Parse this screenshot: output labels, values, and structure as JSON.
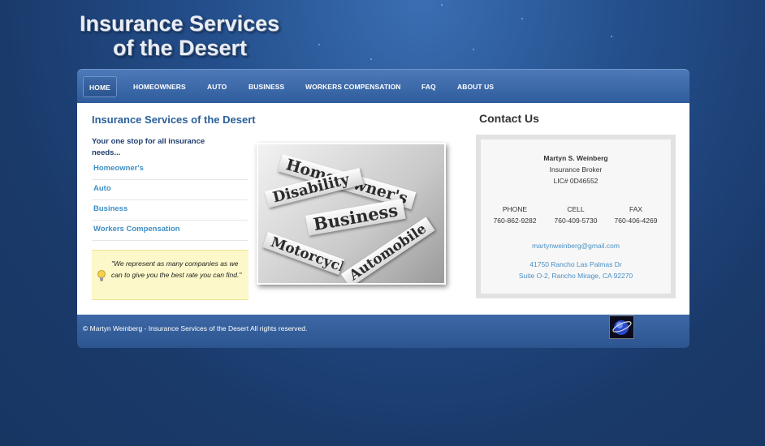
{
  "header": {
    "title_line1": "Insurance Services",
    "title_line2": "of the Desert"
  },
  "nav": {
    "items": [
      {
        "label": "HOME",
        "active": true
      },
      {
        "label": "HOMEOWNERS"
      },
      {
        "label": "AUTO"
      },
      {
        "label": "BUSINESS"
      },
      {
        "label": "WORKERS COMPENSATION"
      },
      {
        "label": "FAQ"
      },
      {
        "label": "ABOUT US"
      }
    ]
  },
  "main": {
    "heading": "Insurance Services of the Desert",
    "tagline": "Your one stop for all insurance needs...",
    "links": [
      "Homeowner's",
      "Auto",
      "Business",
      "Workers Compensation"
    ],
    "quote": "\"We represent as many companies as we can to give you the best rate you can find.\"",
    "quote_icon": "lightbulb-icon",
    "photo_words": [
      "Home Owner's",
      "Disability",
      "Business",
      "Motorcycle",
      "Automobile"
    ]
  },
  "contact": {
    "heading": "Contact Us",
    "name": "Martyn S. Weinberg",
    "title": "Insurance Broker",
    "license": "LIC# 0D46552",
    "phone_label": "PHONE",
    "phone": "760-862-9282",
    "cell_label": "CELL",
    "cell": "760-409-5730",
    "fax_label": "FAX",
    "fax": "760-406-4269",
    "email": "martynweinberg@gmail.com",
    "address_line1": "41750 Rancho Las Palmas Dr",
    "address_line2": "Suite O-2, Rancho Mirage, CA 92270"
  },
  "footer": {
    "copyright": "© Martyn Weinberg - Insurance Services of the Desert All rights reserved.",
    "logo_icon": "site-badge-icon"
  },
  "colors": {
    "background": "#1f4478",
    "nav": "#3a66a5",
    "heading": "#2a5f99",
    "link": "#3f8fc4",
    "quote_bg": "#fcf8c9"
  }
}
